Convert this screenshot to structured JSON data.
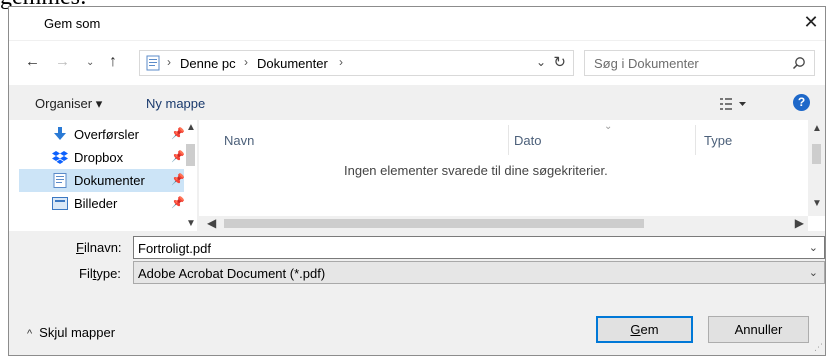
{
  "background_text": "gemmes:",
  "window": {
    "title": "Gem som",
    "close_icon": "close-icon"
  },
  "nav": {
    "back_icon": "back-arrow-icon",
    "forward_icon": "forward-arrow-icon",
    "recent_icon": "chevron-down-icon",
    "up_icon": "up-arrow-icon",
    "breadcrumbs": [
      "Denne pc",
      "Dokumenter"
    ],
    "search_placeholder": "Søg i Dokumenter"
  },
  "toolbar": {
    "organise": "Organiser ▾",
    "new_folder": "Ny mappe",
    "help": "?"
  },
  "navigation_pane": {
    "items": [
      {
        "label": "Overførsler",
        "icon": "download-icon",
        "pinned": true,
        "selected": false
      },
      {
        "label": "Dropbox",
        "icon": "dropbox-icon",
        "pinned": true,
        "selected": false
      },
      {
        "label": "Dokumenter",
        "icon": "documents-icon",
        "pinned": true,
        "selected": true
      },
      {
        "label": "Billeder",
        "icon": "pictures-icon",
        "pinned": true,
        "selected": false
      }
    ]
  },
  "file_list": {
    "columns": [
      "Navn",
      "Dato",
      "Type"
    ],
    "empty_message": "Ingen elementer svarede til dine søgekriterier."
  },
  "form": {
    "filename_label": "Filnavn:",
    "filename_accesskey": "F",
    "filename_value": "Fortroligt.pdf",
    "filetype_label": "Filtype:",
    "filetype_accesskey": "t",
    "filetype_value": "Adobe Acrobat Document (*.pdf)"
  },
  "footer": {
    "hide_folders": "Skjul mapper",
    "save_button": "Gem",
    "save_accesskey": "G",
    "cancel_button": "Annuller"
  },
  "colors": {
    "accent": "#0078d7",
    "selection": "#cce4f7",
    "help": "#1e68c9"
  }
}
